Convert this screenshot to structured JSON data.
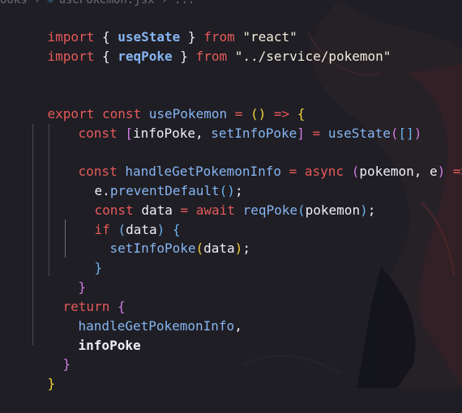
{
  "breadcrumb": {
    "folder": "ooks",
    "file": "usePokemon.jsx",
    "more": "..."
  },
  "code": {
    "line1": {
      "kw1": "import",
      "ob": " { ",
      "name": "useState",
      "cb": " } ",
      "kw2": "from",
      "str": " \"react\""
    },
    "line2": {
      "kw1": "import",
      "ob": " { ",
      "name": "reqPoke",
      "cb": " } ",
      "kw2": "from",
      "str": " \"../service/pokemon\""
    },
    "line5": {
      "kw1": "export",
      "kw2": " const ",
      "name": "usePokemon",
      "eq": " = ",
      "parens": "()",
      "arrow": " => ",
      "brace": "{"
    },
    "line6": {
      "kw": "const ",
      "ob": "[",
      "v1": "infoPoke",
      "comma": ", ",
      "v2": "setInfoPoke",
      "cb": "]",
      "eq": " = ",
      "fn": "useState",
      "op": "(",
      "arr": "[]",
      "cp": ")"
    },
    "line8": {
      "kw": "const ",
      "name": "handleGetPokemonInfo",
      "eq": " = ",
      "async": "async ",
      "op": "(",
      "params": "pokemon, e",
      "cp": ")",
      "arrow": " => ",
      "brace": "{"
    },
    "line9": {
      "obj": "e",
      "dot": ".",
      "fn": "preventDefault",
      "parens": "()",
      "semi": ";"
    },
    "line10": {
      "kw": "const ",
      "name": "data",
      "eq": " = ",
      "await": "await ",
      "fn": "reqPoke",
      "op": "(",
      "arg": "pokemon",
      "cp": ")",
      "semi": ";"
    },
    "line11": {
      "kw": "if ",
      "op": "(",
      "arg": "data",
      "cp": ")",
      "brace": " {"
    },
    "line12": {
      "fn": "setInfoPoke",
      "op": "(",
      "arg": "data",
      "cp": ")",
      "semi": ";"
    },
    "line13": {
      "brace": "}"
    },
    "line14": {
      "brace": "}"
    },
    "line15": {
      "kw": "return",
      "brace": " {"
    },
    "line16": {
      "name": "handleGetPokemonInfo",
      "comma": ","
    },
    "line17": {
      "name": "infoPoke"
    },
    "line18": {
      "brace": "}"
    },
    "line19": {
      "brace": "}"
    }
  },
  "colors": {
    "background": "#1f1e24",
    "keyword": "#e65a5a",
    "function": "#86b5f2",
    "string": "#f2ecdc",
    "bracket_gold": "#f2d23c",
    "bracket_purple": "#d27ae6",
    "bracket_blue": "#6ab4f0"
  }
}
